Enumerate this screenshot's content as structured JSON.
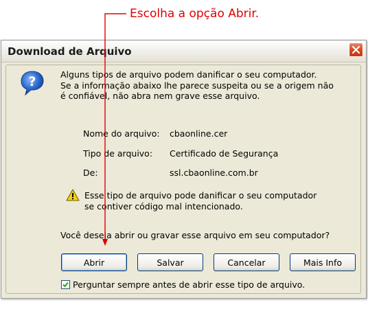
{
  "annotation": {
    "text": "Escolha a opção Abrir."
  },
  "dialog": {
    "title": "Download de Arquivo",
    "warning_lines": [
      "Alguns tipos de arquivo podem danificar o seu computador.",
      "Se a informação abaixo lhe parece suspeita ou se a origem não",
      "é confiável, não abra nem grave esse arquivo."
    ],
    "file_info": {
      "name_label": "Nome do arquivo:",
      "name_value": "cbaonline.cer",
      "type_label": "Tipo de arquivo:",
      "type_value": "Certificado de Segurança",
      "from_label": "De:",
      "from_value": "ssl.cbaonline.com.br"
    },
    "caution_lines": [
      "Esse tipo de arquivo pode danificar o seu computador",
      "se contiver código mal intencionado."
    ],
    "question": "Você deseja abrir ou gravar esse arquivo em seu computador?",
    "buttons": {
      "open": "Abrir",
      "save": "Salvar",
      "cancel": "Cancelar",
      "more_info": "Mais Info"
    },
    "always_ask": {
      "label": "Perguntar sempre antes de abrir esse tipo de arquivo.",
      "checked": true
    }
  },
  "icons": {
    "question": "question-icon",
    "warning": "warning-icon",
    "close": "close-icon"
  },
  "colors": {
    "annotation": "#e00000",
    "close_button": "#d5451c",
    "dialog_background": "#ece9d8",
    "button_border": "#003c74"
  }
}
